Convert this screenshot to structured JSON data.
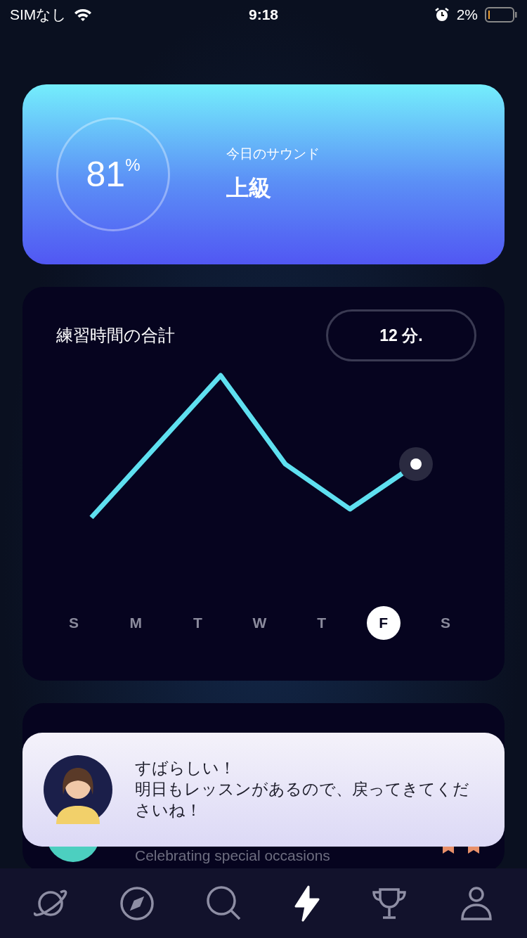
{
  "status_bar": {
    "carrier": "SIMなし",
    "time": "9:18",
    "battery": "2%"
  },
  "sound_card": {
    "percent": "81",
    "percent_sign": "%",
    "label": "今日のサウンド",
    "level_name": "上級"
  },
  "practice_card": {
    "title": "練習時間の合計",
    "total": "12 分.",
    "days": [
      {
        "label": "S",
        "selected": false
      },
      {
        "label": "M",
        "selected": false
      },
      {
        "label": "T",
        "selected": false
      },
      {
        "label": "W",
        "selected": false
      },
      {
        "label": "T",
        "selected": false
      },
      {
        "label": "F",
        "selected": true
      },
      {
        "label": "S",
        "selected": false
      }
    ]
  },
  "lesson_card": {
    "subtitle": "Celebrating special occasions"
  },
  "toast": {
    "lines": [
      "すばらしい！",
      "明日もレッスンがあるので、戻ってきてくださいね！"
    ]
  },
  "tab_bar": [
    {
      "kind": "planet",
      "selected": false
    },
    {
      "kind": "compass",
      "selected": false
    },
    {
      "kind": "search",
      "selected": false
    },
    {
      "kind": "bolt",
      "selected": true
    },
    {
      "kind": "trophy",
      "selected": false
    },
    {
      "kind": "profile",
      "selected": false
    }
  ]
}
